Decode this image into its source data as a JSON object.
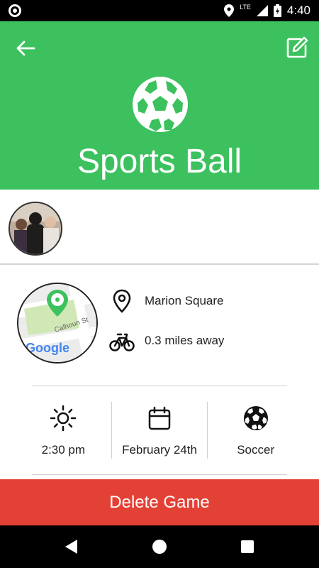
{
  "status_bar": {
    "time": "4:40",
    "network": "LTE"
  },
  "header": {
    "title": "Sports Ball",
    "background_color": "#3cc15e",
    "icons": [
      "back-arrow-icon",
      "edit-icon",
      "soccer-ball-icon"
    ]
  },
  "players": {
    "avatar_count": 1
  },
  "location": {
    "place": "Marion Square",
    "distance": "0.3 miles away",
    "map_label": "Calhoun St",
    "map_brand": "Google"
  },
  "details": {
    "time": "2:30 pm",
    "date": "February 24th",
    "sport": "Soccer"
  },
  "actions": {
    "delete_label": "Delete Game",
    "delete_color": "#e44136"
  }
}
